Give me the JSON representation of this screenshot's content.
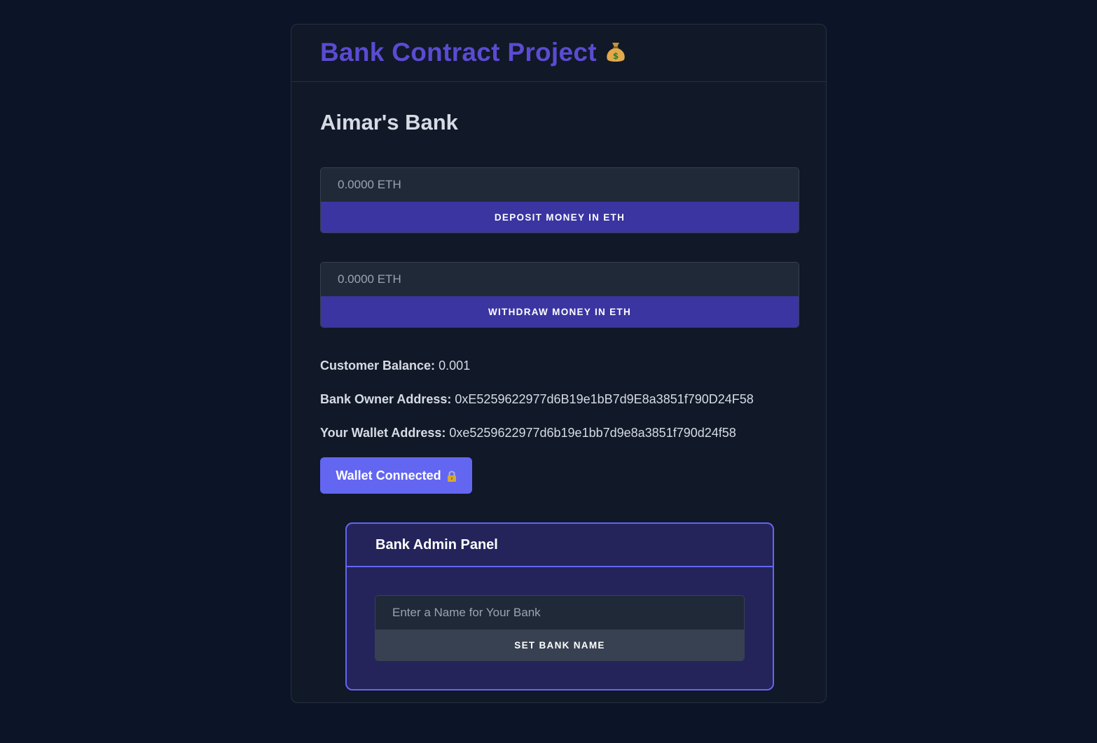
{
  "header": {
    "title": "Bank Contract Project",
    "title_icon": "money-bag-icon"
  },
  "bank": {
    "name": "Aimar's Bank"
  },
  "deposit": {
    "placeholder": "0.0000 ETH",
    "button_label": "Deposit money in ETH"
  },
  "withdraw": {
    "placeholder": "0.0000 ETH",
    "button_label": "Withdraw money in ETH"
  },
  "info": {
    "customer_balance_label": "Customer Balance:",
    "customer_balance_value": "0.001",
    "owner_address_label": "Bank Owner Address:",
    "owner_address_value": "0xE5259622977d6B19e1bB7d9E8a3851f790D24F58",
    "wallet_address_label": "Your Wallet Address:",
    "wallet_address_value": "0xe5259622977d6b19e1bb7d9e8a3851f790d24f58"
  },
  "wallet": {
    "button_label": "Wallet Connected",
    "icon": "lock-icon"
  },
  "admin": {
    "title": "Bank Admin Panel",
    "placeholder": "Enter a Name for Your Bank",
    "button_label": "Set Bank Name"
  },
  "colors": {
    "page_background": "#0c1527",
    "card_background": "#111827",
    "title_accent": "#5b4bd2",
    "primary_button": "#3a35a1",
    "wallet_button": "#6366f1",
    "admin_panel_background": "#24245b",
    "admin_panel_border": "#6366f1",
    "secondary_button": "#374151"
  }
}
